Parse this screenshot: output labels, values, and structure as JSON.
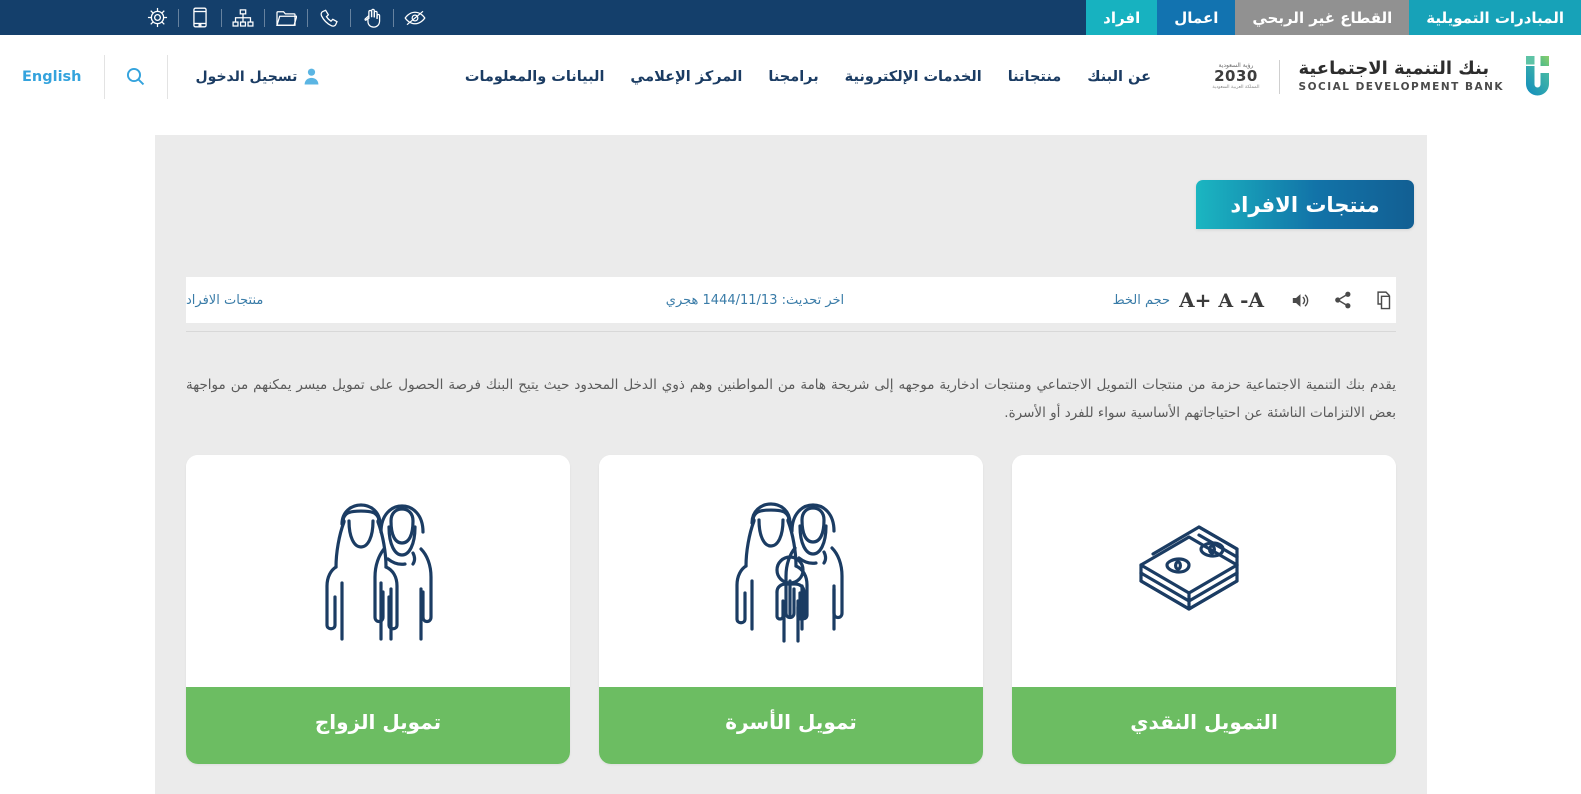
{
  "topbar": {
    "accessibility_icons": [
      "eye-slash-icon",
      "sign-language-hand-icon",
      "phone-icon",
      "folder-icon",
      "sitemap-icon",
      "mobile-icon",
      "settings-gear-icon"
    ],
    "tabs": [
      {
        "label": "المبادرات التمويلية",
        "style": "teal"
      },
      {
        "label": "القطاع غير الربحي",
        "style": "gray"
      },
      {
        "label": "اعمال",
        "style": "blue"
      },
      {
        "label": "افراد",
        "style": "teal2"
      }
    ]
  },
  "header": {
    "brand": {
      "name_ar": "بنك التنمية الاجتماعية",
      "name_en": "SOCIAL DEVELOPMENT BANK",
      "vision_top": "رؤية السعودية",
      "vision_number": "2030",
      "vision_sub": "المملكة العربية السعودية"
    },
    "nav": [
      {
        "label": "عن البنك"
      },
      {
        "label": "منتجاتنا"
      },
      {
        "label": "الخدمات الإلكترونية"
      },
      {
        "label": "برامجنا"
      },
      {
        "label": "المركز الإعلامي"
      },
      {
        "label": "البيانات والمعلومات"
      }
    ],
    "language_link": "English",
    "login_label": "تسجيل الدخول"
  },
  "page": {
    "title": "منتجات الافراد",
    "breadcrumb": "منتجات الافراد",
    "last_updated": "اخر تحديث: 1444/11/13 هجري",
    "font_size_label": "حجم الخط",
    "font_decrease": "A-",
    "font_normal": "A",
    "font_increase": "+A",
    "actions": [
      "copy-icon",
      "share-icon",
      "listen-speaker-icon"
    ],
    "intro": "يقدم بنك التنمية الاجتماعية حزمة من منتجات التمويل الاجتماعي ومنتجات ادخارية موجهه إلى شريحة هامة من المواطنين وهم ذوي الدخل المحدود حيث يتيح البنك فرصة الحصول على تمويل ميسر يمكنهم من مواجهة بعض الالتزامات الناشئة عن احتياجاتهم الأساسية سواء للفرد أو الأسرة."
  },
  "cards": [
    {
      "label": "تمويل الزواج",
      "icon": "couple-icon"
    },
    {
      "label": "تمويل الأسرة",
      "icon": "family-icon"
    },
    {
      "label": "التمويل النقدي",
      "icon": "money-stack-icon"
    }
  ],
  "colors": {
    "header_blue": "#143f6b",
    "teal": "#17a2b8",
    "blue": "#1273b0",
    "gray": "#919191",
    "green": "#6cbd62",
    "link_blue": "#34a3dd",
    "canvas": "#ebebeb"
  }
}
